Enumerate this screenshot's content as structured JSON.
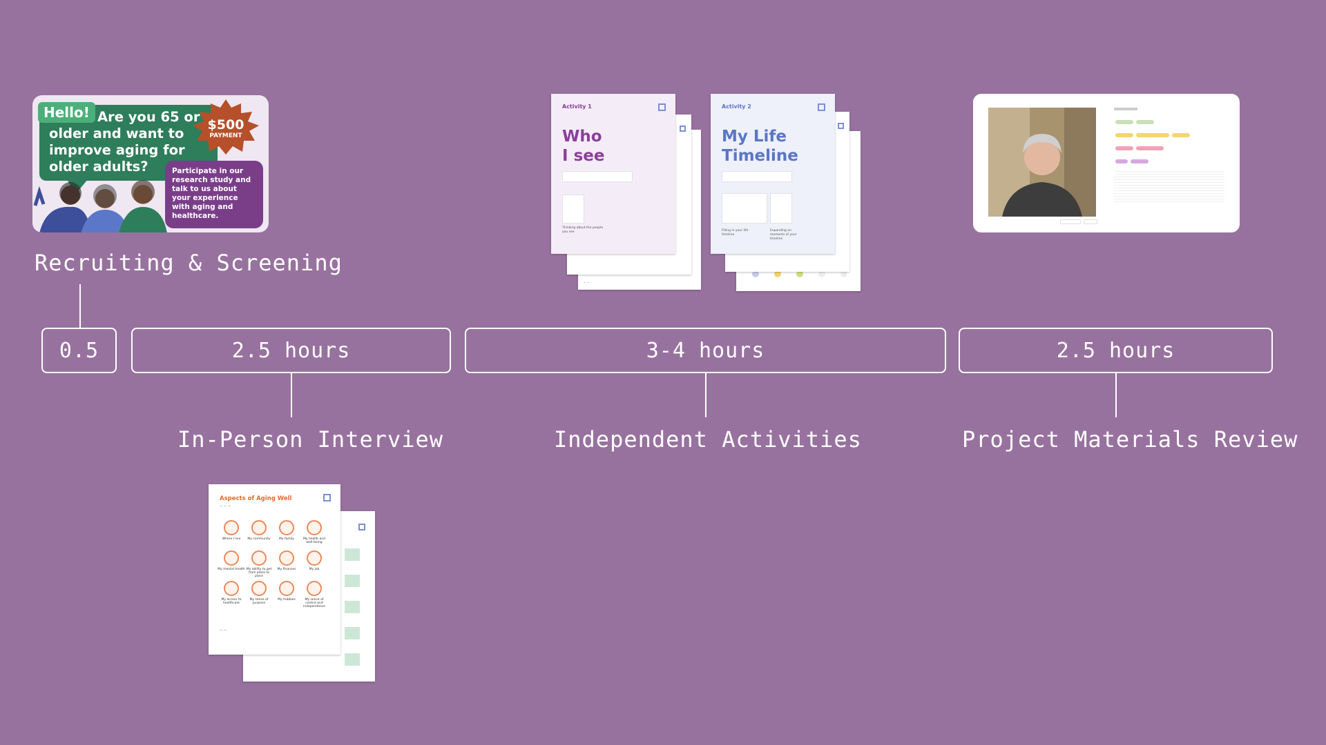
{
  "timeline": {
    "segments": [
      {
        "duration": "0.5"
      },
      {
        "duration": "2.5 hours",
        "label": "In-Person Interview"
      },
      {
        "duration": "3-4 hours",
        "label": "Independent Activities"
      },
      {
        "duration": "2.5 hours",
        "label": "Project Materials Review"
      }
    ],
    "recruiting_label": "Recruiting & Screening"
  },
  "flyer": {
    "hello": "Hello!",
    "question": "Are you 65 or older and want to improve aging for older adults?",
    "amount": "$500",
    "payment": "PAYMENT",
    "invite": "Participate in our research study and talk to us about your experience with aging and healthcare."
  },
  "activities": [
    {
      "tag": "Activity 1",
      "title_line1": "Who",
      "title_line2": "I see",
      "color": "#8a3f9a",
      "bg": "#f4ecf6"
    },
    {
      "tag": "Activity 2",
      "title_line1": "My Life",
      "title_line2": "Timeline",
      "color": "#5a76c4",
      "bg": "#eef0fa"
    }
  ],
  "aging_sheet": {
    "title": "Aspects of Aging Well",
    "items": [
      "Where I live",
      "My community",
      "My family",
      "My health and well-being",
      "My mental health",
      "My ability to get from place to place",
      "My finances",
      "My job",
      "My access to healthcare",
      "My sense of purpose",
      "My hobbies",
      "My sense of control and independence"
    ]
  },
  "colors": {
    "background": "#98729f",
    "line": "#ffffff"
  }
}
